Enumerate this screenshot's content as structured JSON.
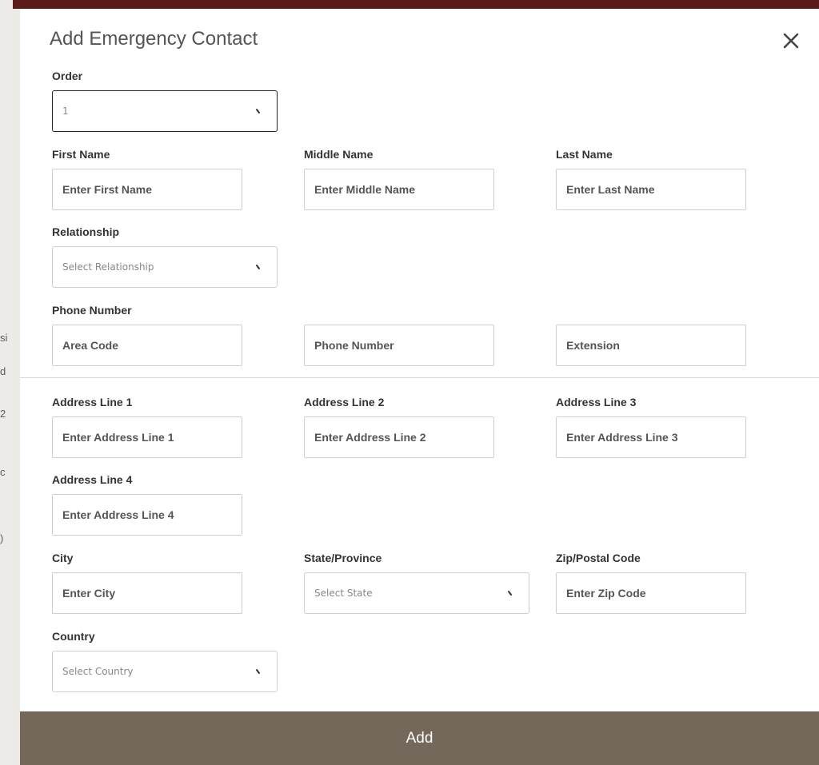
{
  "modal": {
    "title": "Add Emergency Contact",
    "add_label": "Add"
  },
  "background": {
    "edge_fragments": [
      "si",
      "d",
      "2",
      "c",
      ")"
    ]
  },
  "form": {
    "order": {
      "label": "Order",
      "value": "1"
    },
    "first_name": {
      "label": "First Name",
      "placeholder": "Enter First Name"
    },
    "middle_name": {
      "label": "Middle Name",
      "placeholder": "Enter Middle Name"
    },
    "last_name": {
      "label": "Last Name",
      "placeholder": "Enter Last Name"
    },
    "relationship": {
      "label": "Relationship",
      "placeholder": "Select Relationship"
    },
    "phone": {
      "label": "Phone Number",
      "area_code_placeholder": "Area Code",
      "number_placeholder": "Phone Number",
      "extension_placeholder": "Extension"
    },
    "address1": {
      "label": "Address Line 1",
      "placeholder": "Enter Address Line 1"
    },
    "address2": {
      "label": "Address Line 2",
      "placeholder": "Enter Address Line 2"
    },
    "address3": {
      "label": "Address Line 3",
      "placeholder": "Enter Address Line 3"
    },
    "address4": {
      "label": "Address Line 4",
      "placeholder": "Enter Address Line 4"
    },
    "city": {
      "label": "City",
      "placeholder": "Enter City"
    },
    "state": {
      "label": "State/Province",
      "placeholder": "Select State"
    },
    "zip": {
      "label": "Zip/Postal Code",
      "placeholder": "Enter Zip Code"
    },
    "country": {
      "label": "Country",
      "placeholder": "Select Country"
    }
  }
}
